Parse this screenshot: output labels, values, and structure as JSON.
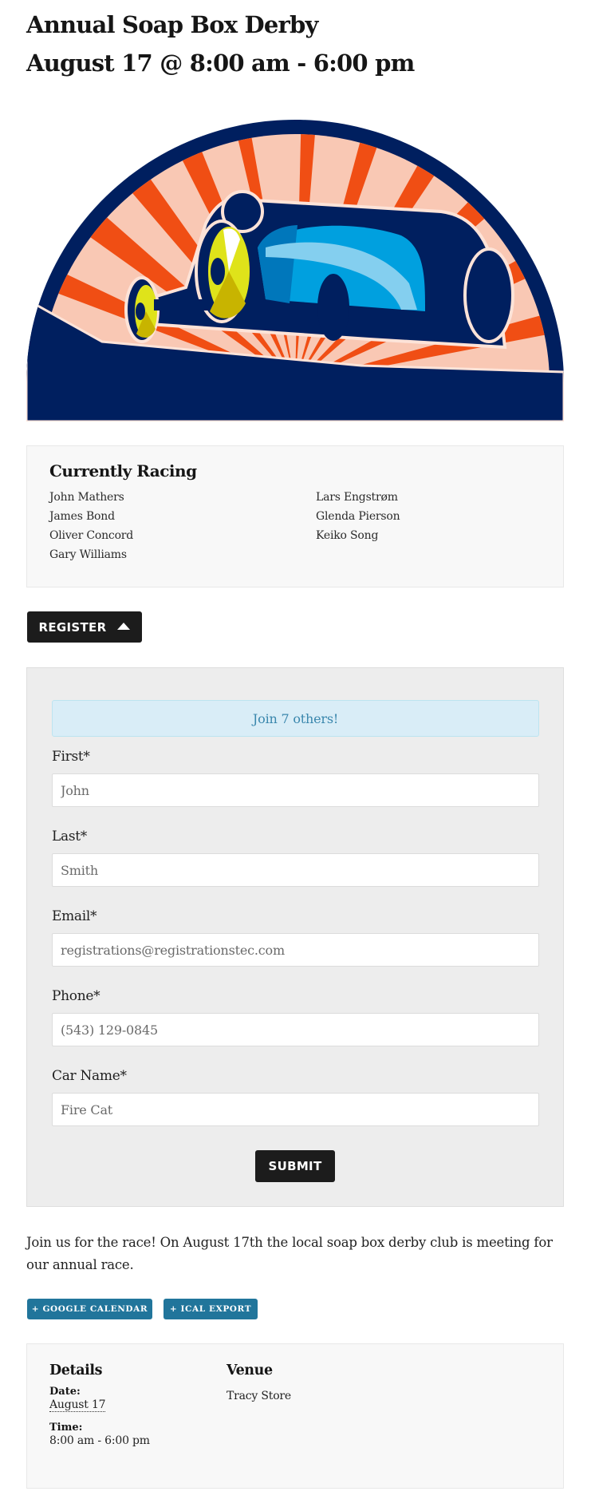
{
  "event": {
    "title": "Annual Soap Box Derby",
    "datetime": "August 17 @ 8:00 am - 6:00 pm",
    "image_alt": "Soap box derby car with sunburst"
  },
  "racing": {
    "heading": "Currently Racing",
    "column1": [
      "John Mathers",
      "James Bond",
      "Oliver Concord",
      "Gary Williams"
    ],
    "column2": [
      "Lars Engstrøm",
      "Glenda Pierson",
      "Keiko Song"
    ]
  },
  "register": {
    "button_label": "REGISTER",
    "toggle_icon": "caret-up-icon"
  },
  "form": {
    "notice": "Join 7 others!",
    "fields": [
      {
        "label": "First*",
        "placeholder": "John"
      },
      {
        "label": "Last*",
        "placeholder": "Smith"
      },
      {
        "label": "Email*",
        "placeholder": "registrations@registrationstec.com"
      },
      {
        "label": "Phone*",
        "placeholder": "(543) 129-0845"
      },
      {
        "label": "Car Name*",
        "placeholder": "Fire Cat"
      }
    ],
    "submit_label": "SUBMIT"
  },
  "description": "Join us for the race! On August 17th the local soap box derby club is meeting for our annual race.",
  "calendar": {
    "google_label": "+ GOOGLE CALENDAR",
    "ical_label": "+ ICAL EXPORT"
  },
  "details": {
    "heading": "Details",
    "date_label": "Date:",
    "date_value": "August 17",
    "time_label": "Time:",
    "time_value": "8:00 am - 6:00 pm"
  },
  "venue": {
    "heading": "Venue",
    "name": "Tracy Store"
  },
  "colors": {
    "accent_blue": "#21759b",
    "dark_button": "#1c1c1c",
    "notice_bg": "#d9edf7",
    "notice_text": "#3a87ad",
    "navy": "#001f5f",
    "orange": "#f04e14",
    "peach": "#f9c8b4"
  }
}
